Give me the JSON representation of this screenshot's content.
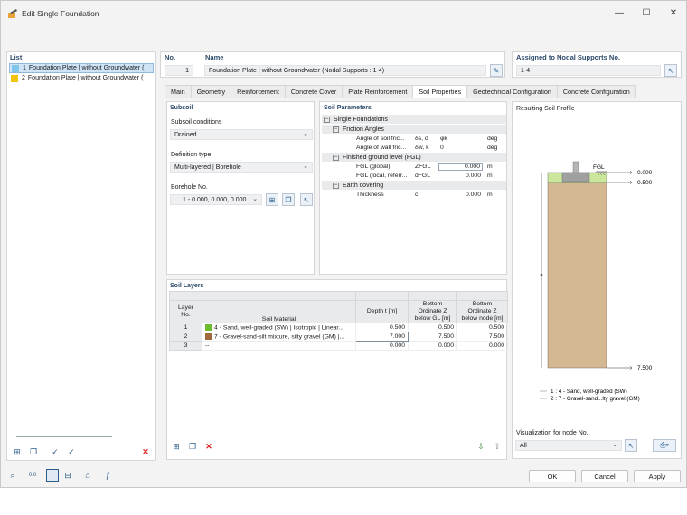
{
  "window": {
    "title": "Edit Single Foundation"
  },
  "list": {
    "header": "List",
    "items": [
      {
        "num": "1",
        "label": "Foundation Plate | without Groundwater (",
        "color": "#7fc7e8",
        "selected": true
      },
      {
        "num": "2",
        "label": "Foundation Plate | without Groundwater (",
        "color": "#f1c40f",
        "selected": false
      }
    ]
  },
  "header": {
    "no_label": "No.",
    "no_value": "1",
    "name_label": "Name",
    "name_value": "Foundation Plate | without Groundwater (Nodal Supports : 1-4)",
    "assigned_label": "Assigned to Nodal Supports No.",
    "assigned_value": "1-4"
  },
  "tabs": [
    "Main",
    "Geometry",
    "Reinforcement",
    "Concrete Cover",
    "Plate Reinforcement",
    "Soil Properties",
    "Geotechnical Configuration",
    "Concrete Configuration"
  ],
  "subsoil": {
    "title": "Subsoil",
    "conditions_label": "Subsoil conditions",
    "conditions_value": "Drained",
    "definition_label": "Definition type",
    "definition_value": "Multi-layered | Borehole",
    "borehole_label": "Borehole No.",
    "borehole_value": "1 - 0.000, 0.000, 0.000 ..."
  },
  "soil_params": {
    "title": "Soil Parameters",
    "group": "Single Foundations",
    "friction_title": "Friction Angles",
    "rows_friction": [
      {
        "name": "Angle of soil fric...",
        "sym": "δs, d",
        "val": "φk",
        "unit": "deg"
      },
      {
        "name": "Angle of wall fric...",
        "sym": "δw, k",
        "val": "0",
        "unit": "deg"
      }
    ],
    "fgl_title": "Finished ground level (FGL)",
    "rows_fgl": [
      {
        "name": "FGL (global)",
        "sym": "ZFGL",
        "val": "0.000",
        "unit": "m"
      },
      {
        "name": "FGL (local, referr...",
        "sym": "dFGL",
        "val": "0.000",
        "unit": "m"
      }
    ],
    "earth_title": "Earth covering",
    "rows_earth": [
      {
        "name": "Thickness",
        "sym": "c",
        "val": "0.000",
        "unit": "m"
      }
    ]
  },
  "soil_layers": {
    "title": "Soil Layers",
    "col_layer": "Layer No.",
    "col_material": "Soil Material",
    "col_depth": "Depth t [m]",
    "col_bgl": "Bottom Ordinate Z below GL [m]",
    "col_bnode": "Bottom Ordinate Z below node [m]",
    "rows": [
      {
        "no": "1",
        "color": "#6dbb2e",
        "material": "4 - Sand, well-graded (SW) | Isotropic | Linear...",
        "depth": "0.500",
        "bgl": "0.500",
        "bnode": "0.500"
      },
      {
        "no": "2",
        "color": "#a0693a",
        "material": "7 - Gravel-sand-silt mixture, silty gravel (GM) |...",
        "depth": "7.000",
        "bgl": "7.500",
        "bnode": "7.500"
      },
      {
        "no": "3",
        "color": "",
        "material": "--",
        "depth": "0.000",
        "bgl": "0.000",
        "bnode": "0.000"
      }
    ]
  },
  "profile": {
    "title": "Resulting Soil Profile",
    "fgl_text": "FGL",
    "levels": [
      "0.000",
      "0.500",
      "7.500"
    ],
    "legend": [
      "1 :  4 - Sand, well-graded (SW)",
      "2 :  7 - Gravel-sand...lty gravel (GM)"
    ],
    "viz_label": "Visualization for node No.",
    "viz_value": "All",
    "colors": {
      "sand": "#cbe79c",
      "gravel": "#d3b891"
    }
  },
  "buttons": {
    "ok": "OK",
    "cancel": "Cancel",
    "apply": "Apply"
  }
}
